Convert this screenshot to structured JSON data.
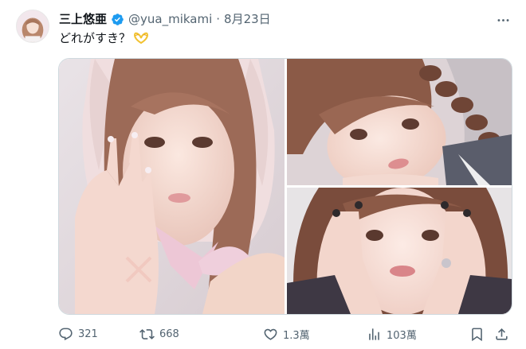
{
  "author": {
    "display_name": "三上悠亜",
    "handle": "@yua_mikami",
    "separator": "·",
    "date": "8月23日",
    "verified": true
  },
  "tweet": {
    "text": "どれがすき？"
  },
  "media": {
    "photo_count": 3
  },
  "actions": {
    "replies": "321",
    "reposts": "668",
    "likes": "1.3萬",
    "views": "103萬"
  },
  "colors": {
    "text": "#0f1419",
    "muted": "#536471",
    "verified": "#1d9bf0",
    "border": "#cfd9de"
  }
}
